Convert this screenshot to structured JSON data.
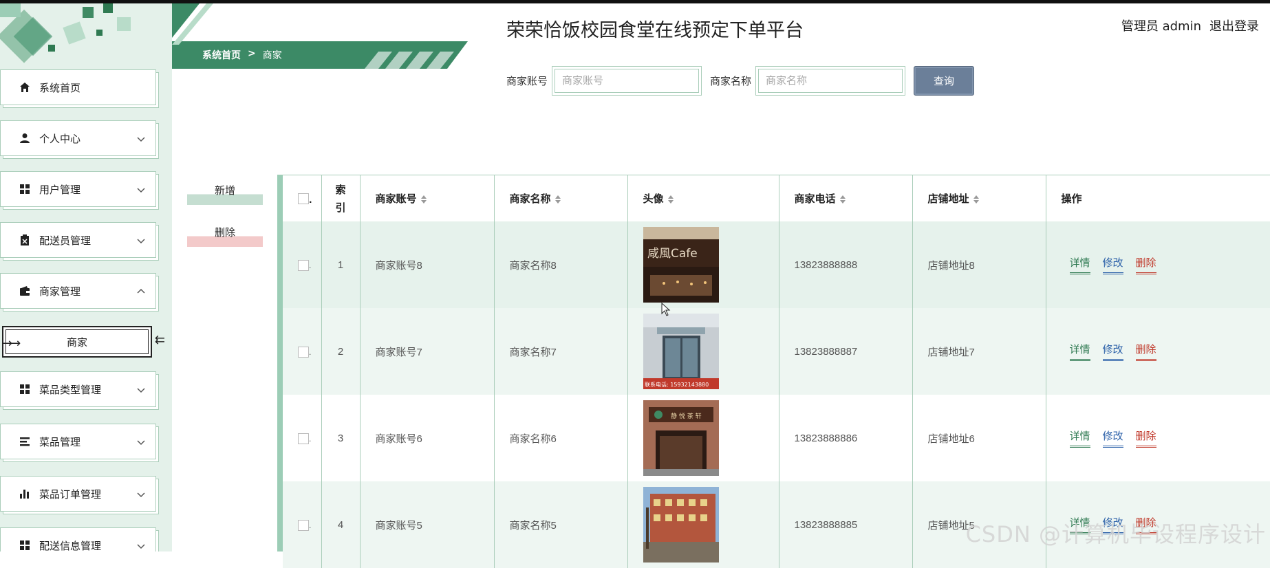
{
  "app_title": "荣荣恰饭校园食堂在线预定下单平台",
  "user": {
    "label": "管理员 admin",
    "logout": "退出登录"
  },
  "breadcrumb": {
    "home": "系统首页",
    "sep": ">",
    "current": "商家"
  },
  "sidebar": {
    "items": [
      {
        "label": "系统首页",
        "icon": "home-icon",
        "expandable": false
      },
      {
        "label": "个人中心",
        "icon": "person-icon",
        "expandable": true
      },
      {
        "label": "用户管理",
        "icon": "grid-icon",
        "expandable": true
      },
      {
        "label": "配送员管理",
        "icon": "clipboard-icon",
        "expandable": true
      },
      {
        "label": "商家管理",
        "icon": "wallet-icon",
        "expandable": true,
        "expanded": true
      },
      {
        "label": "菜品类型管理",
        "icon": "grid-icon",
        "expandable": true
      },
      {
        "label": "菜品管理",
        "icon": "list-icon",
        "expandable": true
      },
      {
        "label": "菜品订单管理",
        "icon": "bar-chart-icon",
        "expandable": true
      },
      {
        "label": "配送信息管理",
        "icon": "grid-icon",
        "expandable": true
      }
    ],
    "submenu": {
      "label": "商家"
    }
  },
  "search": {
    "account_label": "商家账号",
    "account_placeholder": "商家账号",
    "name_label": "商家名称",
    "name_placeholder": "商家名称",
    "button": "查询"
  },
  "actions": {
    "add": "新增",
    "delete": "删除"
  },
  "table": {
    "headers": {
      "check_suffix": ".",
      "index": "索引",
      "account": "商家账号",
      "name": "商家名称",
      "avatar": "头像",
      "phone": "商家电话",
      "address": "店铺地址",
      "ops": "操作"
    },
    "rows": [
      {
        "index": "1",
        "account": "商家账号8",
        "name": "商家名称8",
        "phone": "13823888888",
        "address": "店铺地址8"
      },
      {
        "index": "2",
        "account": "商家账号7",
        "name": "商家名称7",
        "phone": "13823888887",
        "address": "店铺地址7"
      },
      {
        "index": "3",
        "account": "商家账号6",
        "name": "商家名称6",
        "phone": "13823888886",
        "address": "店铺地址6"
      },
      {
        "index": "4",
        "account": "商家账号5",
        "name": "商家名称5",
        "phone": "13823888885",
        "address": "店铺地址5"
      }
    ],
    "op_labels": {
      "detail": "详情",
      "edit": "修改",
      "remove": "删除"
    },
    "avatar_text": {
      "cafe": "咸風Cafe",
      "tea": "静 悦 茶 轩",
      "phone_banner": "联系电话: 15932143880"
    }
  },
  "watermark": "CSDN @计算机毕设程序设计",
  "colors": {
    "accent": "#3c8a66",
    "sidebar_bg": "#e4f1ea",
    "row_odd": "#e6f2ec",
    "row_even": "#eef6f2",
    "query_btn": "#6b7f99"
  }
}
